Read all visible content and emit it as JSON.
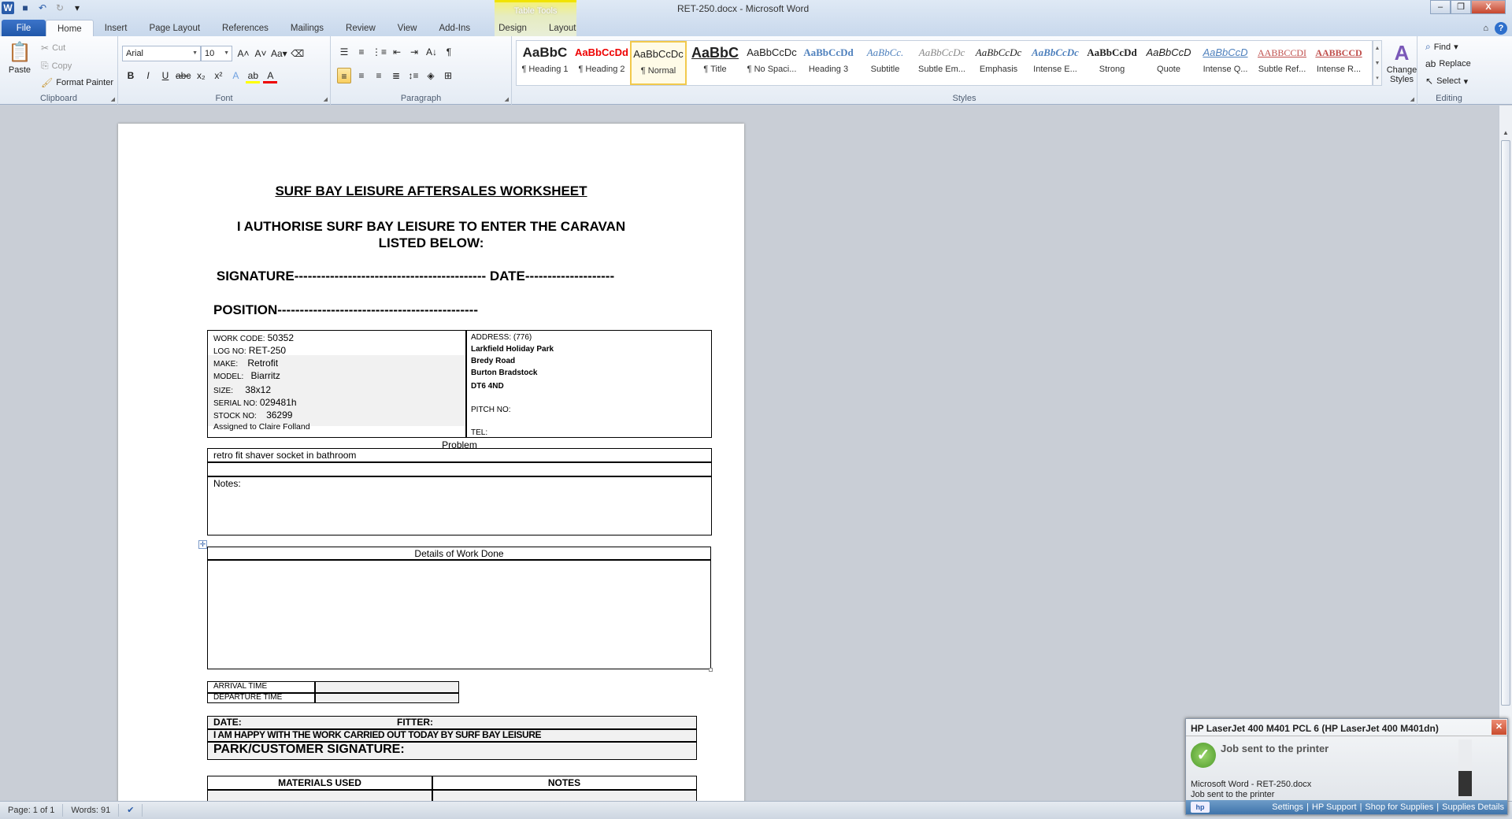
{
  "window": {
    "title": "RET-250.docx - Microsoft Word",
    "contextual_tab": "Table Tools",
    "minimize": "–",
    "restore": "❐",
    "close": "X"
  },
  "tabs": [
    "File",
    "Home",
    "Insert",
    "Page Layout",
    "References",
    "Mailings",
    "Review",
    "View",
    "Add-Ins",
    "Design",
    "Layout"
  ],
  "clipboard": {
    "paste": "Paste",
    "cut": "Cut",
    "copy": "Copy",
    "format_painter": "Format Painter",
    "label": "Clipboard"
  },
  "font": {
    "name": "Arial",
    "size": "10",
    "label": "Font"
  },
  "paragraph": {
    "label": "Paragraph"
  },
  "styles": {
    "label": "Styles",
    "items": [
      {
        "preview": "AaBbC",
        "name": "¶ Heading 1"
      },
      {
        "preview": "AaBbCcDd",
        "name": "¶ Heading 2"
      },
      {
        "preview": "AaBbCcDc",
        "name": "¶ Normal"
      },
      {
        "preview": "AaBbC",
        "name": "¶ Title"
      },
      {
        "preview": "AaBbCcDc",
        "name": "¶ No Spaci..."
      },
      {
        "preview": "AaBbCcDd",
        "name": "Heading 3"
      },
      {
        "preview": "AaBbCc.",
        "name": "Subtitle"
      },
      {
        "preview": "AaBbCcDc",
        "name": "Subtle Em..."
      },
      {
        "preview": "AaBbCcDc",
        "name": "Emphasis"
      },
      {
        "preview": "AaBbCcDc",
        "name": "Intense E..."
      },
      {
        "preview": "AaBbCcDd",
        "name": "Strong"
      },
      {
        "preview": "AaBbCcD",
        "name": "Quote"
      },
      {
        "preview": "AaBbCcD",
        "name": "Intense Q..."
      },
      {
        "preview": "AABBCCDI",
        "name": "Subtle Ref..."
      },
      {
        "preview": "AABBCCD",
        "name": "Intense R..."
      }
    ],
    "change_styles": "Change Styles"
  },
  "editing": {
    "find": "Find",
    "replace": "Replace",
    "select": "Select",
    "label": "Editing"
  },
  "document": {
    "title": "SURF BAY LEISURE AFTERSALES WORKSHEET",
    "authorise": "I AUTHORISE SURF BAY LEISURE TO ENTER THE CARAVAN LISTED BELOW:",
    "signature": "SIGNATURE------------------------------------------- DATE--------------------",
    "position": "POSITION---------------------------------------------",
    "info": {
      "work_code_label": "WORK CODE:",
      "work_code": "50352",
      "log_no_label": "LOG NO:",
      "log_no": "RET-250",
      "make_label": "MAKE:",
      "make": "Retrofit",
      "model_label": "MODEL:",
      "model": "Biarritz",
      "size_label": "SIZE:",
      "size": "38x12",
      "serial_label": "SERIAL  NO:",
      "serial": "029481h",
      "stock_label": "STOCK NO:",
      "stock": "36299",
      "assigned": "Assigned to Claire Folland"
    },
    "address": {
      "label": "ADDRESS:",
      "code": "(776)",
      "line1": "Larkfield Holiday Park",
      "line2": "Bredy Road",
      "line3": "Burton Bradstock",
      "postcode": "DT6 4ND",
      "pitch": "PITCH NO:",
      "tel": "TEL:"
    },
    "problem_label": "Problem",
    "problem": "retro fit shaver socket in bathroom",
    "notes_label": "Notes:",
    "details_label": "Details of Work Done",
    "arrival": "ARRIVAL  TIME",
    "departure": "DEPARTURE  TIME",
    "date": "DATE:",
    "fitter": "FITTER:",
    "happy": "I AM HAPPY WITH THE WORK CARRIED OUT TODAY BY SURF BAY LEISURE",
    "customer_sig": "PARK/CUSTOMER SIGNATURE:",
    "materials": "MATERIALS USED",
    "notes": "NOTES"
  },
  "status": {
    "page": "Page: 1 of 1",
    "words": "Words: 91"
  },
  "notification": {
    "title": "HP LaserJet 400 M401 PCL 6 (HP LaserJet 400 M401dn)",
    "heading": "Job sent to the printer",
    "line1": "Microsoft Word - RET-250.docx",
    "line2": "Job sent to the printer",
    "level": 0.45,
    "links": [
      "Settings",
      "HP Support",
      "Shop for Supplies",
      "Supplies Details"
    ],
    "logo": "hp"
  }
}
